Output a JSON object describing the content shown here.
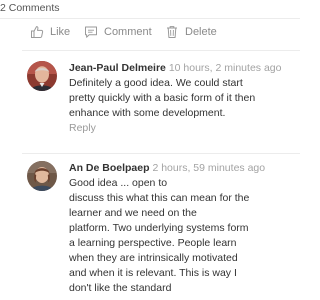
{
  "comments_header": {
    "count_text": "2 Comments"
  },
  "actions": {
    "like_label": "Like",
    "comment_label": "Comment",
    "delete_label": "Delete"
  },
  "comments": [
    {
      "author": "Jean-Paul Delmeire",
      "time": "10 hours, 2 minutes ago",
      "body_lines": [
        "Definitely a good idea. We could start",
        "pretty quickly with a basic form of it then",
        "enhance with some development."
      ],
      "reply_label": "Reply"
    },
    {
      "author": "An De Boelpaep",
      "time": "2 hours, 59 minutes ago",
      "body_lines": [
        "Good idea ... open to",
        "discuss this what this can mean for the",
        "learner and we need on the",
        "platform.  Two underlying systems form",
        "a learning perspective.  People learn",
        "when they are intrinsically motivated",
        "and when it is relevant.    This is way I",
        "don't like the standard"
      ]
    }
  ],
  "colors": {
    "text": "#333333",
    "muted": "#8a8a8a",
    "timestamp": "#a3a3a3",
    "divider": "#ececec"
  }
}
